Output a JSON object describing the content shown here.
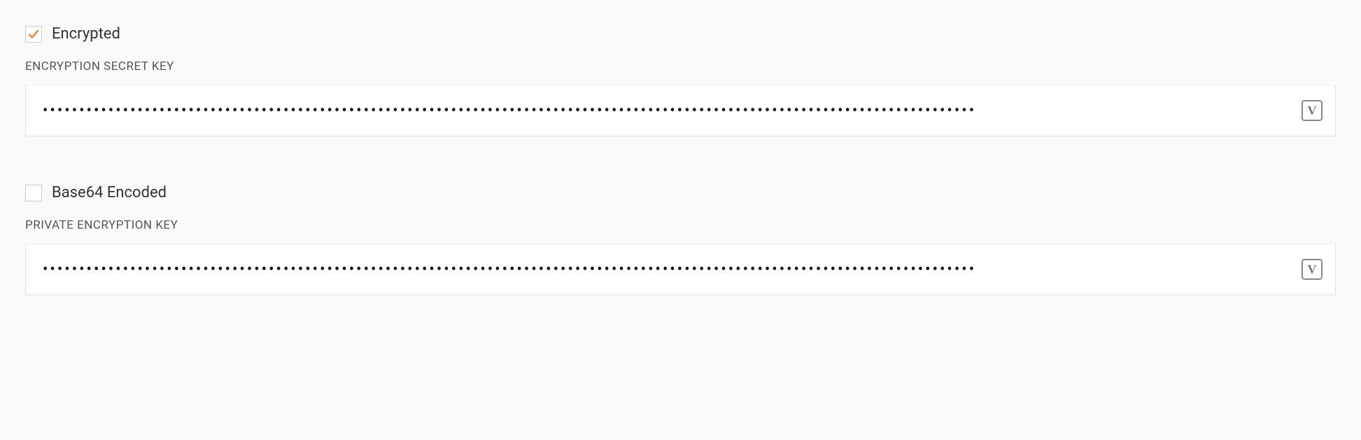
{
  "encrypted": {
    "checked": true,
    "label": "Encrypted",
    "fieldLabel": "ENCRYPTION SECRET KEY",
    "value": "••••••••••••••••••••••••••••••••••••••••••••••••••••••••••••••••••••••••••••••••••••••••••••••••••••••••••••••••••••••••••••••••",
    "vaultLetter": "V"
  },
  "base64": {
    "checked": false,
    "label": "Base64 Encoded",
    "fieldLabel": "PRIVATE ENCRYPTION KEY",
    "value": "••••••••••••••••••••••••••••••••••••••••••••••••••••••••••••••••••••••••••••••••••••••••••••••••••••••••••••••••••••••••••••••••",
    "vaultLetter": "V"
  }
}
